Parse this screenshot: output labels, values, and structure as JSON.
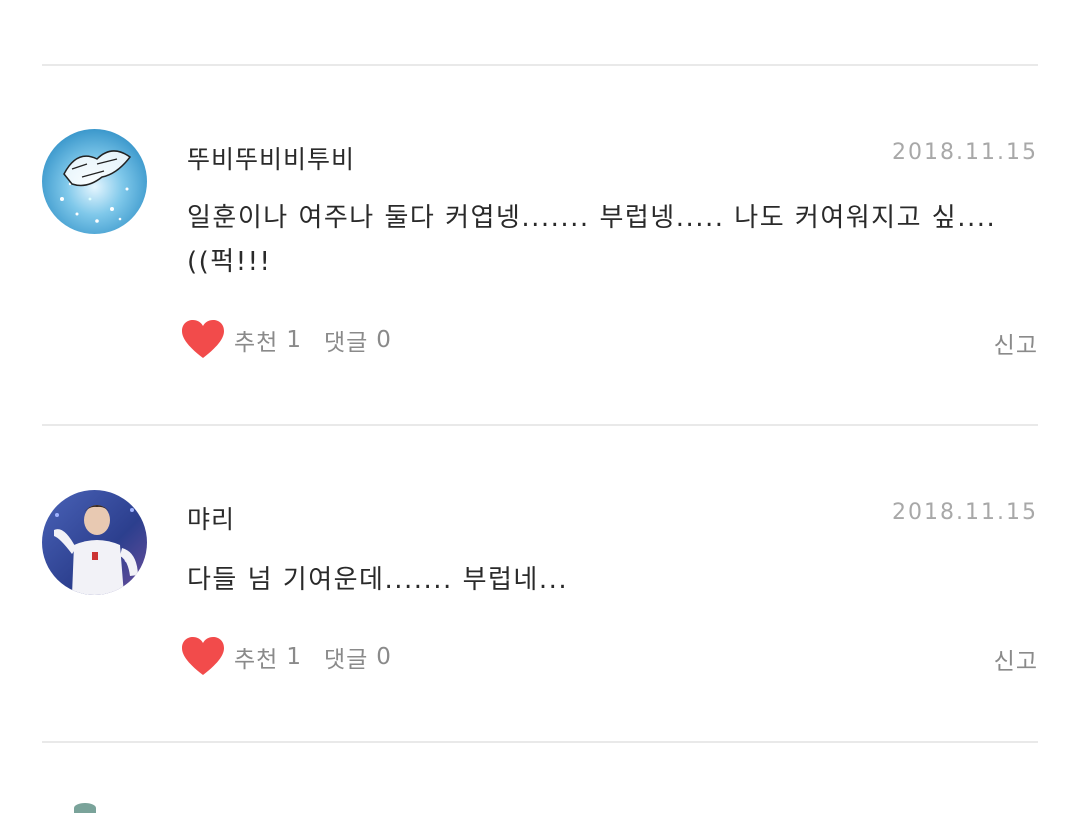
{
  "comments": [
    {
      "author": "뚜비뚜비비투비",
      "date": "2018.11.15",
      "text": "일훈이나 여주나 둘다 커엽넹....... 부럽넹..... 나도 커여워지고 싶.... ((퍽!!!",
      "likes_label": "추천",
      "likes_count": "1",
      "replies_label": "댓글",
      "replies_count": "0",
      "report_label": "신고"
    },
    {
      "author": "먀리",
      "date": "2018.11.15",
      "text": "다들 넘 기여운데....... 부럽네...",
      "likes_label": "추천",
      "likes_count": "1",
      "replies_label": "댓글",
      "replies_count": "0",
      "report_label": "신고"
    }
  ],
  "colors": {
    "heart": "#f24b4b",
    "divider": "#e9e9e9",
    "muted": "#8a8a8a",
    "date": "#a8a8a8"
  }
}
